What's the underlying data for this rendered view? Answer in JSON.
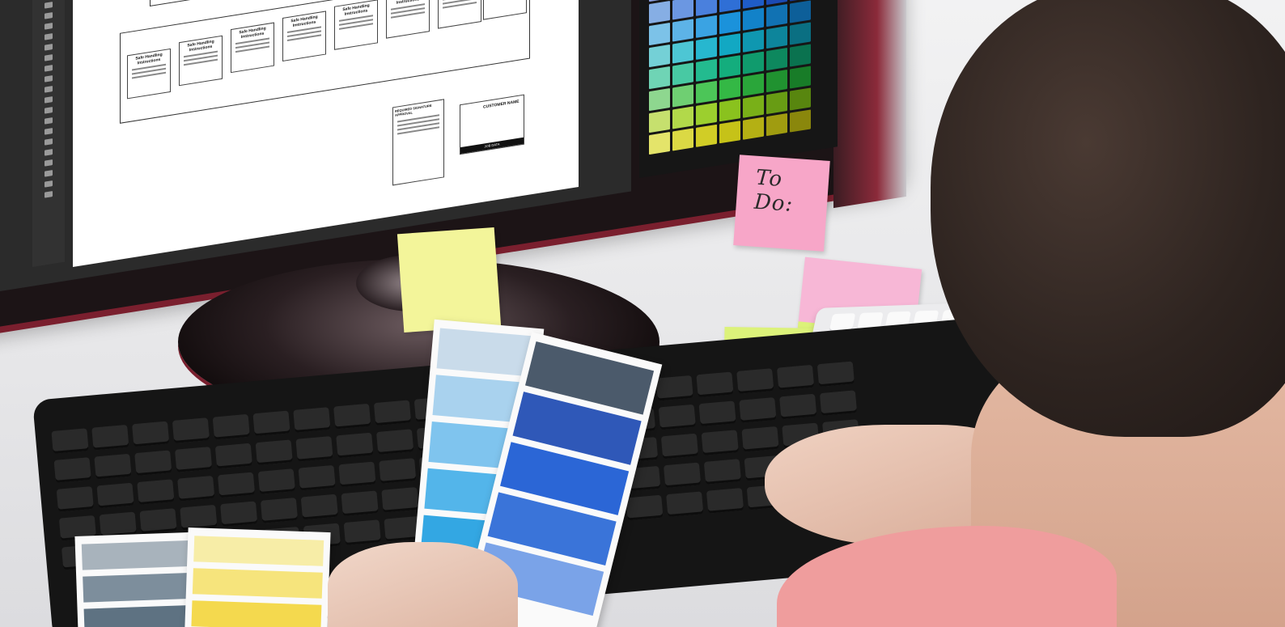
{
  "scene": {
    "sticky_todo_text": "To Do:",
    "document": {
      "sheet_title": "Safe Handling Instructions",
      "approval_title": "REQUIRED SIGNATURE APPROVAL",
      "customer_name": "CUSTOMER NAME",
      "job_data": "JOB DATA"
    }
  },
  "colors": {
    "monitor_red": "#7a1f2e",
    "sticky_yellow": "#f3f59a",
    "sticky_pink": "#f7a6c8",
    "sticky_green": "#dcf27a",
    "sticky_orange": "#ffb03a",
    "shirt_pink": "#ef9d9d"
  },
  "palette_swatches": [
    "#8da0e0",
    "#7188dd",
    "#5c6fd8",
    "#3e55c9",
    "#2c3fb8",
    "#2435a4",
    "#1e2b8f",
    "#86aee4",
    "#6b97e2",
    "#4a80dd",
    "#2f6fd6",
    "#1f5cc6",
    "#1c4ab3",
    "#163c9e",
    "#7cc2e8",
    "#5db3e7",
    "#3aa3e3",
    "#1b92db",
    "#1282c9",
    "#1172b3",
    "#0d5f99",
    "#74d0d6",
    "#4dc6d4",
    "#27b7cf",
    "#12a8c3",
    "#0f97b0",
    "#0d859b",
    "#0a6f82",
    "#6fd4b5",
    "#48c9a3",
    "#23bb8f",
    "#14ad7d",
    "#109b6d",
    "#0d885e",
    "#0a724f",
    "#8ed78f",
    "#6fcf72",
    "#4cc558",
    "#34b845",
    "#2aa63a",
    "#209230",
    "#187c28",
    "#c6e06e",
    "#b2d94a",
    "#9ccf2e",
    "#8ac21e",
    "#79b018",
    "#689c14",
    "#58860f",
    "#e4e46a",
    "#dbd944",
    "#d1cd26",
    "#c6c218",
    "#b4b014",
    "#a09c10",
    "#8a870c"
  ],
  "card_chips": {
    "blue_light": [
      "#c9dbea",
      "#a9d2ee",
      "#7fc4ee",
      "#53b5ea",
      "#33a7e3",
      "#1f99d9"
    ],
    "blue_dark": [
      "#4b5a6b",
      "#2f58b8",
      "#2b66d6",
      "#3a74d9",
      "#7aa3e8"
    ],
    "grey": [
      "#a8b3bc",
      "#7d8e9c",
      "#5e7282"
    ],
    "yellow": [
      "#f7eda7",
      "#f6e47c",
      "#f4d94e"
    ]
  }
}
